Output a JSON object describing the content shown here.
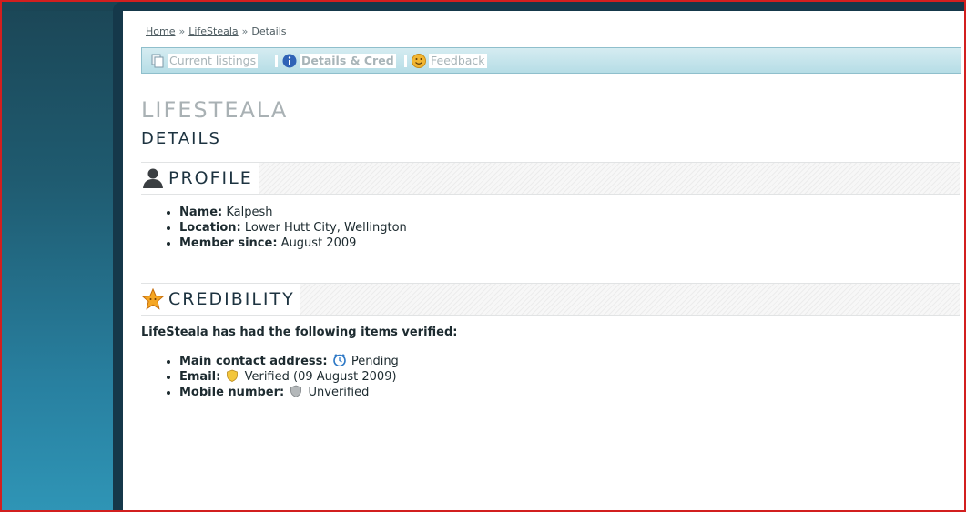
{
  "breadcrumb": {
    "home": "Home",
    "user": "LifeSteala",
    "current": "Details",
    "separator": "»"
  },
  "tabs": {
    "listings": "Current listings",
    "details": "Details & Cred",
    "feedback": "Feedback"
  },
  "page": {
    "title": "LIFESTEALA",
    "subtitle": "DETAILS"
  },
  "profile": {
    "heading": "PROFILE",
    "name_label": "Name:",
    "name_value": "Kalpesh",
    "location_label": "Location:",
    "location_value": "Lower Hutt City, Wellington",
    "member_label": "Member since:",
    "member_value": "August 2009"
  },
  "credibility": {
    "heading": "CREDIBILITY",
    "intro": "LifeSteala has had the following items verified:",
    "address_label": "Main contact address:",
    "address_status": "Pending",
    "email_label": "Email:",
    "email_status": "Verified (09 August 2009)",
    "mobile_label": "Mobile number:",
    "mobile_status": "Unverified"
  },
  "icons": {
    "listings": "pages-icon",
    "details": "info-icon",
    "feedback": "smiley-icon",
    "profile": "person-icon",
    "credibility": "star-icon",
    "pending": "clock-icon",
    "verified": "gold-shield-icon",
    "unverified": "grey-shield-icon"
  },
  "colors": {
    "frame": "#d21f1f",
    "tabbar": "#b6dde6",
    "accent": "#1d3340"
  }
}
